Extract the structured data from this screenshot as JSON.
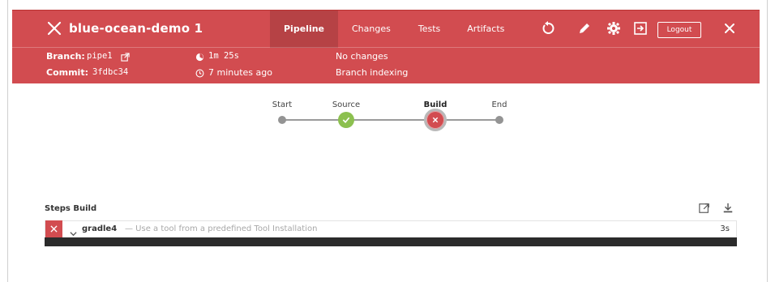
{
  "header": {
    "title": "blue-ocean-demo 1",
    "tabs": [
      "Pipeline",
      "Changes",
      "Tests",
      "Artifacts"
    ],
    "logout_label": "Logout",
    "bg_color": "#d24c50"
  },
  "meta": {
    "branch_label": "Branch:",
    "branch_value": "pipe1",
    "commit_label": "Commit:",
    "commit_value": "3fdbc34",
    "duration": "1m 25s",
    "time_ago": "7 minutes ago",
    "changes": "No changes",
    "cause": "Branch indexing"
  },
  "pipeline": {
    "stages": [
      "Start",
      "Source",
      "Build",
      "End"
    ],
    "status": [
      "start",
      "success",
      "failed",
      "end"
    ],
    "colors": {
      "success": "#8cc04f",
      "failed": "#d24c50",
      "neutral": "#949494"
    }
  },
  "steps": {
    "title": "Steps Build",
    "items": [
      {
        "name": "gradle4",
        "description": "— Use a tool from a predefined Tool Installation",
        "duration": "3s",
        "status": "failed"
      }
    ]
  }
}
